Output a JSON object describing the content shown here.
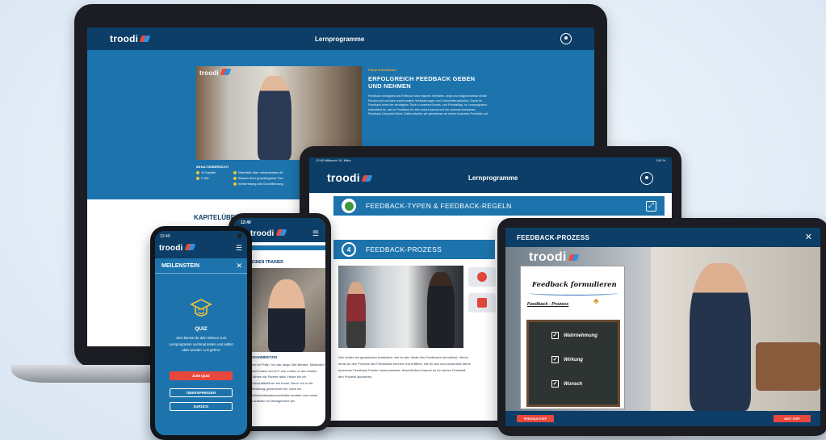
{
  "laptop": {
    "logo": "troodi",
    "header_title": "Lernprogramme",
    "video_logo": "troodi",
    "author": "Philip Schwidetzki",
    "course_title": "ERFOLGREICH FEEDBACK GEBEN UND NEHMEN",
    "course_body": "Feedback ermöglicht uns Reflexion über eigenes Verhalten, zeigt uns möglicherweise blinde Flecken auf und kann somit positive Veränderungen und Fortschritte anstoßen. Damit ist Feedback eines der wichtigsten Tools in unserem Berufs- und Privatalltag. Im Lernprogramm erarbeitest du, wie du Feedback für dich nutzen kannst und ein maximal wirksames Feedback-Gespräch führst. Dabei arbeiten wir gemeinsam an einem konkreten Praxisfall und",
    "overview_title": "INHALTSÜBERSICHT",
    "overview_left": [
      "10 Kapitel",
      "2 Std."
    ],
    "overview_right": [
      "Überblick über verschiedene Ar",
      "Wissen über grundlegende Fee",
      "Vorbereitung und Durchführung"
    ],
    "chapter_heading": "KAPITELÜBE"
  },
  "tablet_middle": {
    "status_time": "12:40  Mittwoch 18. März",
    "status_battery": "100 %",
    "logo": "troodi",
    "header_title": "Lernprogramme",
    "section1_title": "FEEDBACK-TYPEN & FEEDBACK-REGELN",
    "section2_number": "4",
    "section2_title": "FEEDBACK-PROZESS",
    "body": "Nun wollen wir gemeinsam erarbeiten, wie du den Inhalt des Feedbacks formulierst. Hierzu lernst du den Prozess des Feedbacks kennen und erfährst, wie du klar und konstruktiv deine einzelnen Feedback-Punkte kommunizierst. Anschließend kannst du für deinen Praxisfall den Prozess skizzieren."
  },
  "tablet_front": {
    "title": "FEEDBACK-PROZESS",
    "close_glyph": "✕",
    "board_logo": "troodi",
    "board_heading": "Feedback formulieren",
    "board_sub": "Feedback - Prozess",
    "checklist": [
      "Wahrnehmung",
      "Wirkung",
      "Wunsch"
    ],
    "prev_label": "PREVIOUS STEP",
    "next_label": "NEXT STEP"
  },
  "phone_back": {
    "time": "12:40",
    "logo": "troodi",
    "section_label": "EINEN TRAINER",
    "name": "SCHWIDETZKI",
    "bio": "me ist Philip. Ich war lange Zeit Berater, Moderator und Coach bei ACT und zudem in den letzten Jahren als Partner aktiv. Heute bin ich Geschäftsführer bei troodi. Bevor ich in die Beratung gewechselt bin, habe ich Wirtschaftswissenschaften studiert und meine Laufbahn im Management der"
  },
  "phone_front": {
    "time": "12:40",
    "logo": "troodi",
    "title": "MEILENSTEIN",
    "close_glyph": "✕",
    "quiz_heading": "QUIZ",
    "quiz_text": "Jetzt kannst du dein Wissen zum Lernprogramm nochmal testen und selbst aktiv werden. Los geht's!",
    "btn_quiz": "ZUM QUIZ",
    "btn_skip": "ÜBERSPRINGEN",
    "btn_back": "ZURÜCK"
  }
}
